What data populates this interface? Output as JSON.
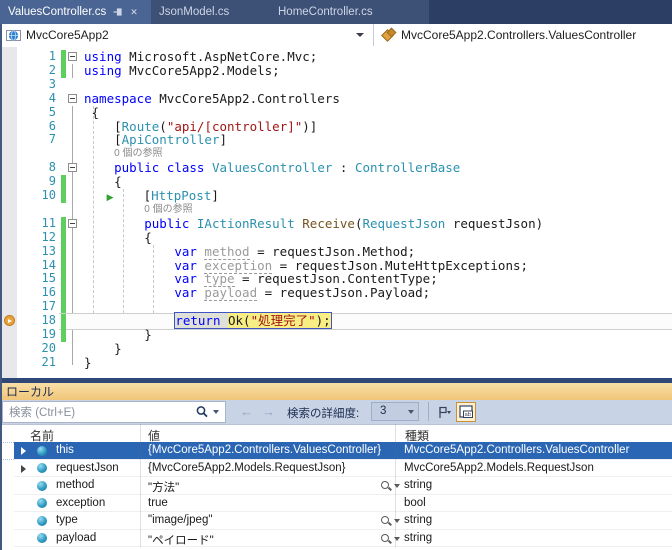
{
  "tabs": [
    {
      "label": "ValuesController.cs",
      "active": true
    },
    {
      "label": "JsonModel.cs",
      "active": false
    },
    {
      "label": "HomeController.cs",
      "active": false
    }
  ],
  "navbar": {
    "project": "MvcCore5App2",
    "member": "MvcCore5App2.Controllers.ValuesController"
  },
  "editor": {
    "codelens_label": "0 個の参照",
    "lines": [
      {
        "n": 1,
        "fold": true,
        "bar": true,
        "segs": [
          [
            "using",
            "k"
          ],
          [
            " Microsoft.AspNetCore.Mvc;",
            "p"
          ]
        ]
      },
      {
        "n": 2,
        "bar": true,
        "segs": [
          [
            "using",
            "k"
          ],
          [
            " MvcCore5App2.Models;",
            "p"
          ]
        ]
      },
      {
        "n": 3,
        "segs": []
      },
      {
        "n": 4,
        "fold": true,
        "segs": [
          [
            "namespace",
            "k"
          ],
          [
            " MvcCore5App2.Controllers",
            "p"
          ]
        ]
      },
      {
        "n": 5,
        "segs": [
          [
            " {",
            "p"
          ]
        ]
      },
      {
        "n": 6,
        "segs": [
          [
            "    [",
            "p"
          ],
          [
            "Route",
            "t"
          ],
          [
            "(",
            "p"
          ],
          [
            "\"api/[controller]\"",
            "s"
          ],
          [
            ")]",
            "p"
          ]
        ]
      },
      {
        "n": 7,
        "segs": [
          [
            "    [",
            "p"
          ],
          [
            "ApiController",
            "t"
          ],
          [
            "]",
            "p"
          ]
        ]
      },
      {
        "lens": true,
        "indent": 4
      },
      {
        "n": 8,
        "fold": true,
        "segs": [
          [
            "    ",
            "p"
          ],
          [
            "public",
            "k"
          ],
          [
            " ",
            "p"
          ],
          [
            "class",
            "k"
          ],
          [
            " ",
            "p"
          ],
          [
            "ValuesController",
            "t"
          ],
          [
            " : ",
            "p"
          ],
          [
            "ControllerBase",
            "t"
          ]
        ]
      },
      {
        "n": 9,
        "bar": true,
        "segs": [
          [
            "    {",
            "p"
          ]
        ]
      },
      {
        "n": 10,
        "bar": true,
        "segs": [
          [
            "   ",
            "p"
          ],
          [
            "▶",
            "g"
          ],
          [
            "    [",
            "p"
          ],
          [
            "HttpPost",
            "t"
          ],
          [
            "]",
            "p"
          ]
        ]
      },
      {
        "lens": true,
        "indent": 8
      },
      {
        "n": 11,
        "fold": true,
        "bar": true,
        "segs": [
          [
            "        ",
            "p"
          ],
          [
            "public",
            "k"
          ],
          [
            " ",
            "p"
          ],
          [
            "IActionResult",
            "t"
          ],
          [
            " ",
            "p"
          ],
          [
            "Receive",
            "m"
          ],
          [
            "(",
            "p"
          ],
          [
            "RequestJson",
            "t"
          ],
          [
            " requestJson)",
            "p"
          ]
        ]
      },
      {
        "n": 12,
        "bar": true,
        "segs": [
          [
            "        {",
            "p"
          ]
        ]
      },
      {
        "n": 13,
        "bar": true,
        "segs": [
          [
            "            ",
            "p"
          ],
          [
            "var",
            "k"
          ],
          [
            " ",
            "p"
          ],
          [
            "method",
            "d"
          ],
          [
            " = requestJson.Method;",
            "p"
          ]
        ]
      },
      {
        "n": 14,
        "bar": true,
        "segs": [
          [
            "            ",
            "p"
          ],
          [
            "var",
            "k"
          ],
          [
            " ",
            "p"
          ],
          [
            "exception",
            "d"
          ],
          [
            " = requestJson.MuteHttpExceptions;",
            "p"
          ]
        ]
      },
      {
        "n": 15,
        "bar": true,
        "segs": [
          [
            "            ",
            "p"
          ],
          [
            "var",
            "k"
          ],
          [
            " ",
            "p"
          ],
          [
            "type",
            "d"
          ],
          [
            " = requestJson.ContentType;",
            "p"
          ]
        ]
      },
      {
        "n": 16,
        "bar": true,
        "segs": [
          [
            "            ",
            "p"
          ],
          [
            "var",
            "k"
          ],
          [
            " ",
            "p"
          ],
          [
            "payload",
            "d"
          ],
          [
            " = requestJson.Payload;",
            "p"
          ]
        ]
      },
      {
        "n": 17,
        "bar": true,
        "segs": []
      },
      {
        "n": 18,
        "bar": true,
        "current": true,
        "indent": 12,
        "ret": "return ",
        "head": "Ok(",
        "str": "\"処理完了\"",
        "tail": ");"
      },
      {
        "n": 19,
        "bar": true,
        "segs": [
          [
            "        }",
            "p"
          ]
        ]
      },
      {
        "n": 20,
        "segs": [
          [
            "    }",
            "p"
          ]
        ]
      },
      {
        "n": 21,
        "segs": [
          [
            "}",
            "p"
          ]
        ]
      }
    ]
  },
  "locals": {
    "title": "ローカル",
    "toolbar": {
      "search_placeholder": "検索 (Ctrl+E)",
      "depth_label": "検索の詳細度:",
      "depth_value": "3",
      "ab_icon_text": "ab"
    },
    "columns": [
      "名前",
      "値",
      "種類"
    ],
    "rows": [
      {
        "name": "this",
        "value": "{MvcCore5App2.Controllers.ValuesController}",
        "type": "MvcCore5App2.Controllers.ValuesController",
        "expandable": true,
        "selected": true
      },
      {
        "name": "requestJson",
        "value": "{MvcCore5App2.Models.RequestJson}",
        "type": "MvcCore5App2.Models.RequestJson",
        "expandable": true
      },
      {
        "name": "method",
        "value": "\"方法\"",
        "type": "string",
        "mag": true
      },
      {
        "name": "exception",
        "value": "true",
        "type": "bool"
      },
      {
        "name": "type",
        "value": "\"image/jpeg\"",
        "type": "string",
        "mag": true
      },
      {
        "name": "payload",
        "value": "\"ペイロード\"",
        "type": "string",
        "mag": true
      }
    ]
  },
  "colors": {
    "selection_blue": "#2a66b4",
    "change_bar_green": "#5ecf5e",
    "current_statement_yellow": "#f8ee84",
    "keyword_blue": "#0000ff",
    "type_teal": "#2b91af",
    "string_red": "#a31515",
    "locals_title_gold": "#f3ca80",
    "tab_active_blue": "#4a6494",
    "breakpoint_arrow_orange": "#e8a33d"
  }
}
